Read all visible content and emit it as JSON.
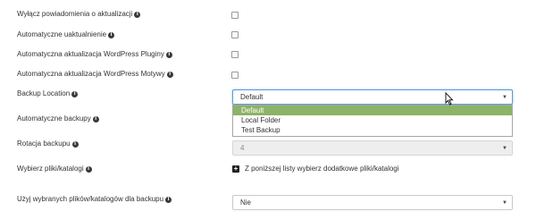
{
  "labels": {
    "disable_notifications": "Wyłącz powiadomienia o aktualizacji",
    "auto_updates": "Automatyczne uaktualnienie",
    "auto_plugins": "Automatyczna aktualizacja WordPress Pluginy",
    "auto_themes": "Automatyczna aktualizacja WordPress Motywy",
    "backup_location": "Backup Location",
    "auto_backups": "Automatyczne backupy",
    "backup_rotation": "Rotacja backupu",
    "choose_files": "Wybierz pliki/katalogi",
    "use_selected": "Użyj wybranych plików/katalogów dla backupu"
  },
  "backup_location": {
    "selected": "Default",
    "options": [
      "Default",
      "Local Folder",
      "Test Backup"
    ]
  },
  "backup_rotation_value": "4",
  "add_from_list_text": "Z poniższej listy wybierz dodatkowe pliki/katalogi",
  "use_selected_value": "Nie",
  "icons": {
    "info": "info-icon",
    "dropdown_arrow": "chevron-down-icon",
    "plus": "plus-icon",
    "cursor": "mouse-pointer-icon"
  },
  "colors": {
    "selected_option_bg": "#8db366",
    "focus_border": "#5b9dd9"
  }
}
